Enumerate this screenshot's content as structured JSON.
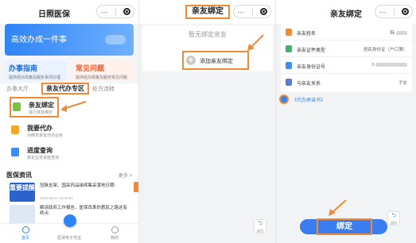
{
  "colors": {
    "accent": "#2f84f5",
    "highlight": "#f08a37"
  },
  "capsule": {
    "menu": "···"
  },
  "screen1": {
    "title": "日照医保",
    "banner": "高效办成一件事",
    "guides": [
      {
        "title": "办事指南",
        "sub": "提供经办政策及服务事项办理"
      },
      {
        "title": "常见问题",
        "sub": "提供经办政策及服务常见问题"
      }
    ],
    "tabs": [
      "办事大厅",
      "亲友代办专区",
      "处方流转"
    ],
    "services": [
      {
        "name": "亲友绑定",
        "desc": "进行亲友绑定",
        "icon": "user-bind-icon"
      },
      {
        "name": "我要代办",
        "desc": "为绑定亲友代办业务",
        "icon": "proxy-icon"
      },
      {
        "name": "进度查询",
        "desc": "亲友业务进度查询",
        "icon": "progress-icon"
      }
    ],
    "news": {
      "title": "医保资讯",
      "more": "更多 >",
      "items": [
        {
          "thumb": "重要提醒",
          "text": "冠脉支架、国采药品接续集采落地日期:",
          "date": "2023-05-17 14:43:09"
        },
        {
          "thumb": "",
          "text": "解读政府工作报告，医保改革的惠民之路这有终点:",
          "date": ""
        }
      ]
    },
    "tabbar": [
      "首页",
      "医保电子凭证",
      "我的"
    ]
  },
  "screen2": {
    "title": "亲友绑定",
    "empty": "暂无绑定亲友",
    "add": "添加亲友绑定",
    "back": "返回"
  },
  "screen3": {
    "title": "亲友绑定",
    "fields": [
      {
        "label": "亲友姓名",
        "value": "韩"
      },
      {
        "label": "亲友证件类型",
        "value": "居民身份证（户口簿）"
      },
      {
        "label": "亲友身份证号",
        "value": "3"
      },
      {
        "label": "与亲友关系",
        "value": "子女"
      }
    ],
    "agreement": "《代办承诺书》",
    "bind": "绑定",
    "back": "返回"
  }
}
